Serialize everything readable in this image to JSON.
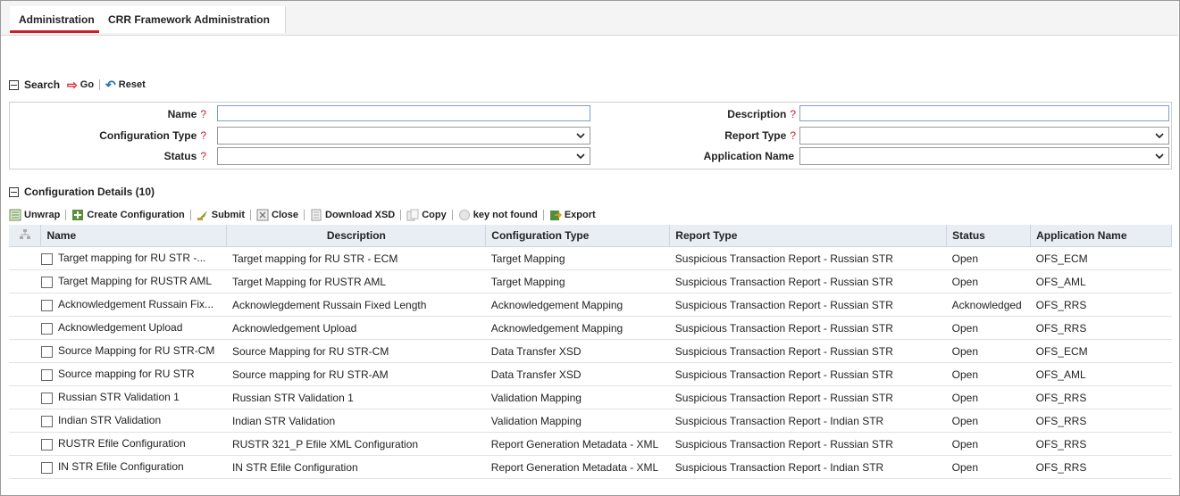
{
  "tabs": [
    {
      "label": "Administration",
      "active": true
    },
    {
      "label": "CRR Framework Administration",
      "active": false
    }
  ],
  "search": {
    "title": "Search",
    "go_label": "Go",
    "reset_label": "Reset",
    "fields": {
      "name": {
        "label": "Name",
        "value": ""
      },
      "description": {
        "label": "Description",
        "value": ""
      },
      "configuration_type": {
        "label": "Configuration Type",
        "value": ""
      },
      "report_type": {
        "label": "Report Type",
        "value": ""
      },
      "status": {
        "label": "Status",
        "value": ""
      },
      "application_name": {
        "label": "Application Name",
        "value": ""
      }
    },
    "help_glyph": "?"
  },
  "details": {
    "title": "Configuration Details (10)",
    "toolbar": [
      "Unwrap",
      "Create Configuration",
      "Submit",
      "Close",
      "Download XSD",
      "Copy",
      "key not found",
      "Export"
    ],
    "columns": [
      "Name",
      "Description",
      "Configuration Type",
      "Report Type",
      "Status",
      "Application Name"
    ],
    "rows": [
      [
        "Target mapping for RU STR -...",
        "Target mapping for RU STR - ECM",
        "Target Mapping",
        "Suspicious Transaction Report - Russian STR",
        "Open",
        "OFS_ECM"
      ],
      [
        "Target Mapping for RUSTR AML",
        "Target Mapping for RUSTR AML",
        "Target Mapping",
        "Suspicious Transaction Report - Russian STR",
        "Open",
        "OFS_AML"
      ],
      [
        "Acknowledgement Russain Fix...",
        "Acknowlegdement Russain Fixed Length",
        "Acknowledgement Mapping",
        "Suspicious Transaction Report - Russian STR",
        "Acknowledged",
        "OFS_RRS"
      ],
      [
        "Acknowledgement Upload",
        "Acknowledgement Upload",
        "Acknowledgement Mapping",
        "Suspicious Transaction Report - Russian STR",
        "Open",
        "OFS_RRS"
      ],
      [
        "Source Mapping for RU STR-CM",
        "Source Mapping for RU STR-CM",
        "Data Transfer XSD",
        "Suspicious Transaction Report - Russian STR",
        "Open",
        "OFS_ECM"
      ],
      [
        "Source mapping for RU STR",
        "Source mapping for RU STR-AM",
        "Data Transfer XSD",
        "Suspicious Transaction Report - Russian STR",
        "Open",
        "OFS_AML"
      ],
      [
        "Russian STR Validation 1",
        "Russian STR Validation 1",
        "Validation Mapping",
        "Suspicious Transaction Report - Russian STR",
        "Open",
        "OFS_RRS"
      ],
      [
        "Indian STR Validation",
        "Indian STR Validation",
        "Validation Mapping",
        "Suspicious Transaction Report - Indian STR",
        "Open",
        "OFS_RRS"
      ],
      [
        "RUSTR Efile Configuration",
        "RUSTR 321_P Efile  XML Configuration",
        "Report Generation Metadata - XML",
        "Suspicious Transaction Report - Russian STR",
        "Open",
        "OFS_RRS"
      ],
      [
        "IN STR Efile Configuration",
        "IN STR Efile Configuration",
        "Report Generation Metadata - XML",
        "Suspicious Transaction Report - Indian STR",
        "Open",
        "OFS_RRS"
      ]
    ]
  }
}
